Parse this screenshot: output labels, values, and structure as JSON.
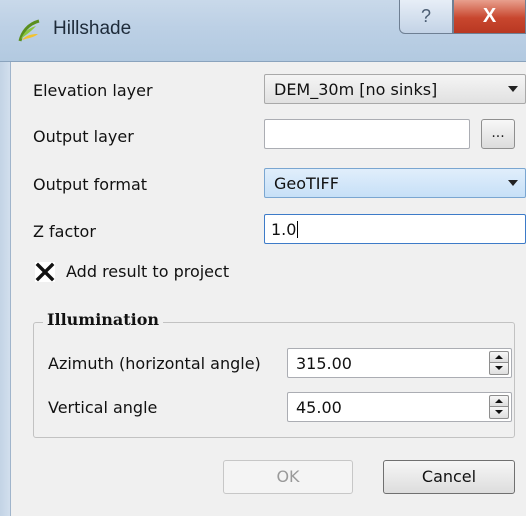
{
  "window": {
    "title": "Hillshade",
    "icon": "qgis-icon",
    "help_label": "?",
    "close_label": "X"
  },
  "fields": {
    "elevation_layer": {
      "label": "Elevation layer",
      "value": "DEM_30m [no sinks]"
    },
    "output_layer": {
      "label": "Output layer",
      "value": "",
      "browse_label": "..."
    },
    "output_format": {
      "label": "Output format",
      "value": "GeoTIFF"
    },
    "z_factor": {
      "label": "Z factor",
      "value": "1.0"
    },
    "add_result": {
      "label": "Add result to project",
      "checked": true
    }
  },
  "illumination": {
    "title": "Illumination",
    "azimuth": {
      "label": "Azimuth (horizontal angle)",
      "value": "315.00"
    },
    "vertical": {
      "label": "Vertical angle",
      "value": "45.00"
    }
  },
  "buttons": {
    "ok": "OK",
    "ok_enabled": false,
    "cancel": "Cancel"
  },
  "colors": {
    "accent": "#3d7bc8",
    "close": "#c8462e",
    "combo_highlight": "#c7e0f7"
  }
}
